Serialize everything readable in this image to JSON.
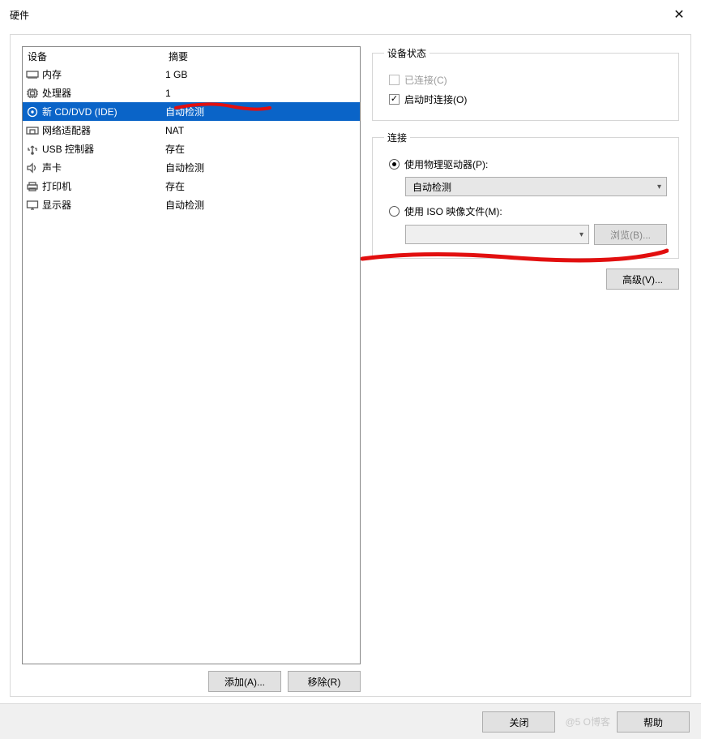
{
  "window": {
    "title": "硬件",
    "close_button": "关闭",
    "help_button": "帮助"
  },
  "left": {
    "header_device": "设备",
    "header_summary": "摘要",
    "add_button": "添加(A)...",
    "remove_button": "移除(R)",
    "rows": [
      {
        "icon": "memory",
        "label": "内存",
        "summary": "1 GB",
        "selected": false
      },
      {
        "icon": "cpu",
        "label": "处理器",
        "summary": "1",
        "selected": false
      },
      {
        "icon": "disc",
        "label": "新 CD/DVD (IDE)",
        "summary": "自动检测",
        "selected": true
      },
      {
        "icon": "nic",
        "label": "网络适配器",
        "summary": "NAT",
        "selected": false
      },
      {
        "icon": "usb",
        "label": "USB 控制器",
        "summary": "存在",
        "selected": false
      },
      {
        "icon": "sound",
        "label": "声卡",
        "summary": "自动检测",
        "selected": false
      },
      {
        "icon": "printer",
        "label": "打印机",
        "summary": "存在",
        "selected": false
      },
      {
        "icon": "display",
        "label": "显示器",
        "summary": "自动检测",
        "selected": false
      }
    ]
  },
  "status_group": {
    "legend": "设备状态",
    "connected_label": "已连接(C)",
    "connected_checked": false,
    "connected_enabled": false,
    "connect_at_poweron_label": "启动时连接(O)",
    "connect_at_poweron_checked": true
  },
  "connection_group": {
    "legend": "连接",
    "physical_label": "使用物理驱动器(P):",
    "physical_selected": true,
    "physical_combo": "自动检测",
    "iso_label": "使用 ISO 映像文件(M):",
    "iso_selected": false,
    "iso_combo": "",
    "browse_button": "浏览(B)..."
  },
  "advanced_button": "高级(V)...",
  "watermark": "@5   O博客"
}
